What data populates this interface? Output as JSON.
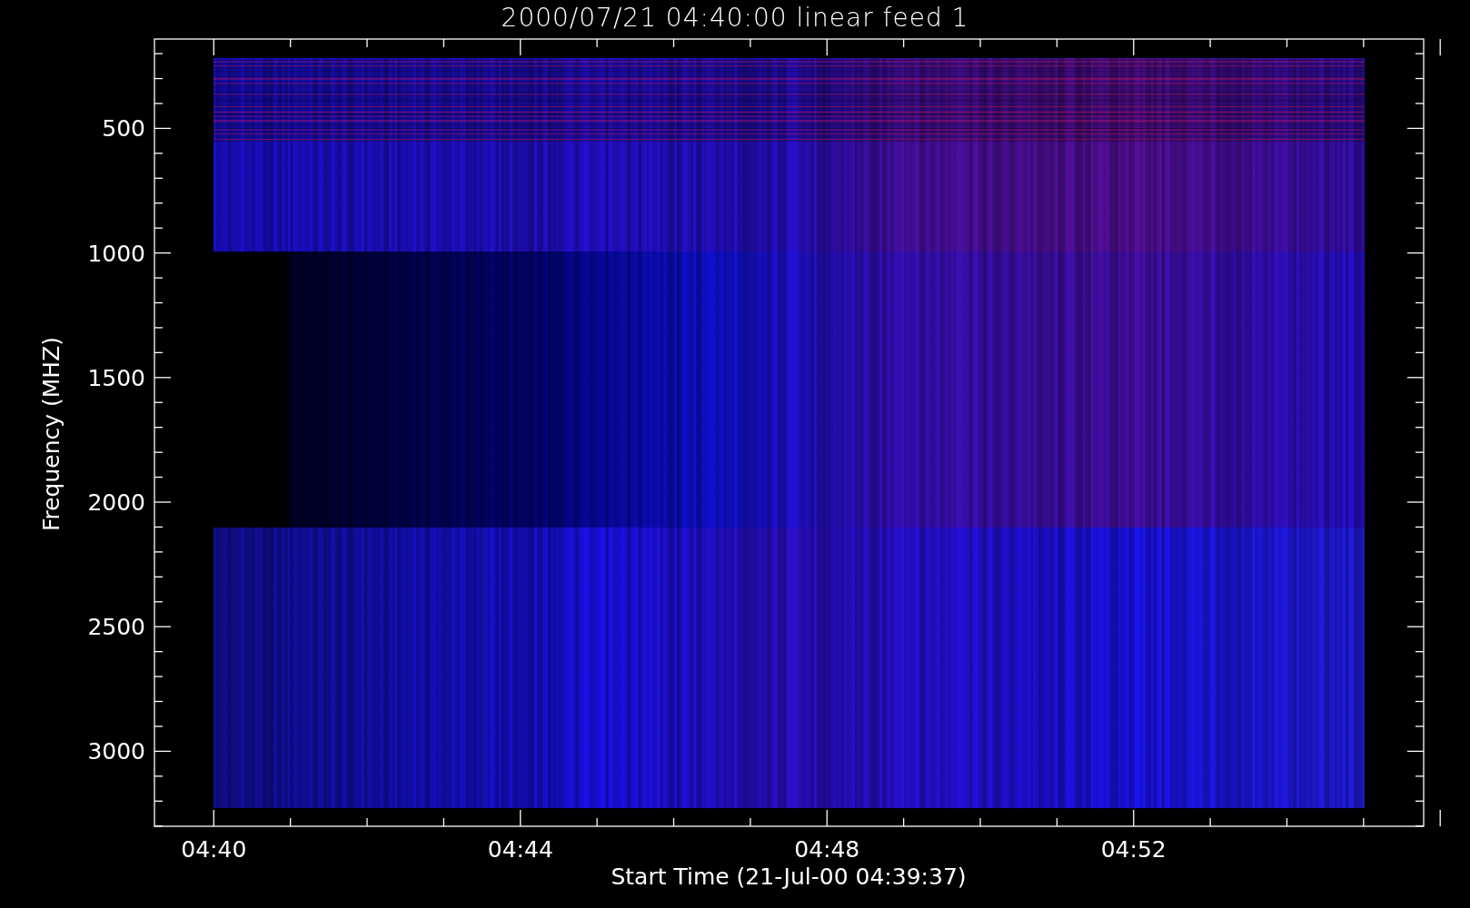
{
  "title": "2000/07/21 04:40:00 linear feed 1",
  "plot": {
    "ylabel": "Frequency (MHZ)",
    "xlabel": "Start Time (21-Jul-00 04:39:37)",
    "yticks": [
      "500",
      "1000",
      "1500",
      "2000",
      "2500",
      "3000"
    ],
    "xticks": [
      "04:40",
      "04:44",
      "04:48",
      "04:52"
    ]
  }
}
